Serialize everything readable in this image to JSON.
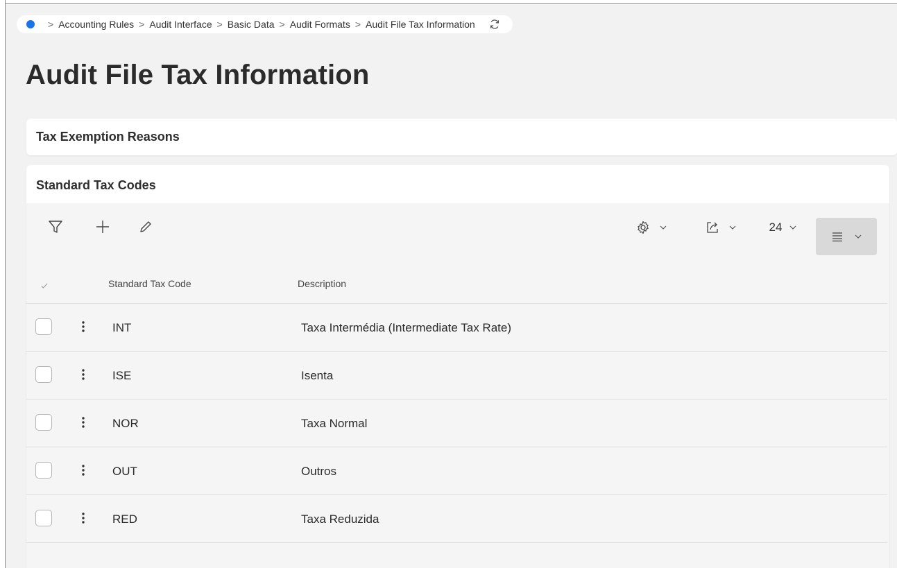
{
  "breadcrumb": {
    "items": [
      "Accounting Rules",
      "Audit Interface",
      "Basic Data",
      "Audit Formats"
    ],
    "current": "Audit File Tax Information"
  },
  "page": {
    "title": "Audit File Tax Information"
  },
  "cards": {
    "exemption_title": "Tax Exemption Reasons",
    "std_title": "Standard Tax Codes"
  },
  "toolbar": {
    "page_size": "24"
  },
  "table": {
    "columns": [
      "Standard Tax Code",
      "Description"
    ],
    "rows": [
      {
        "code": "INT",
        "description": "Taxa Intermédia (Intermediate Tax Rate)"
      },
      {
        "code": "ISE",
        "description": "Isenta"
      },
      {
        "code": "NOR",
        "description": "Taxa Normal"
      },
      {
        "code": "OUT",
        "description": "Outros"
      },
      {
        "code": "RED",
        "description": "Taxa Reduzida"
      }
    ]
  },
  "colors": {
    "accent": "#1a73e8",
    "background": "#f3f2f3",
    "toolbar_bg": "#f5f5f5"
  }
}
